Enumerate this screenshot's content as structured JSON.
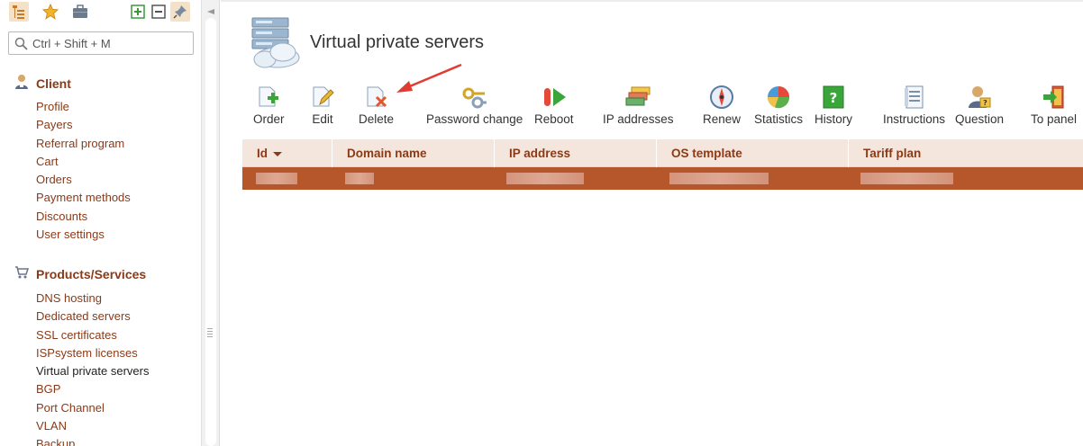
{
  "sidebar": {
    "search": {
      "placeholder": "Ctrl + Shift + M",
      "value": ""
    },
    "sections": [
      {
        "title": "Client",
        "icon": "user-icon",
        "items": [
          "Profile",
          "Payers",
          "Referral program",
          "Cart",
          "Orders",
          "Payment methods",
          "Discounts",
          "User settings"
        ]
      },
      {
        "title": "Products/Services",
        "icon": "cart-icon",
        "items": [
          "DNS hosting",
          "Dedicated servers",
          "SSL certificates",
          "ISPsystem licenses",
          "Virtual private servers",
          "BGP",
          "Port Channel",
          "VLAN",
          "Backup"
        ]
      }
    ]
  },
  "page": {
    "title": "Virtual private servers"
  },
  "toolbar": {
    "order": "Order",
    "edit": "Edit",
    "delete": "Delete",
    "password_change": "Password change",
    "reboot": "Reboot",
    "ip_addresses": "IP addresses",
    "renew": "Renew",
    "statistics": "Statistics",
    "history": "History",
    "instructions": "Instructions",
    "question": "Question",
    "to_panel": "To panel"
  },
  "table": {
    "columns": [
      "Id",
      "Domain name",
      "IP address",
      "OS template",
      "Tariff plan"
    ],
    "sorted_column": "Id",
    "selected_row_color": "#b6562b"
  },
  "colors": {
    "accent": "#8a3a17",
    "header_bg": "#f4e6dc",
    "arrow": "#e03c31"
  }
}
